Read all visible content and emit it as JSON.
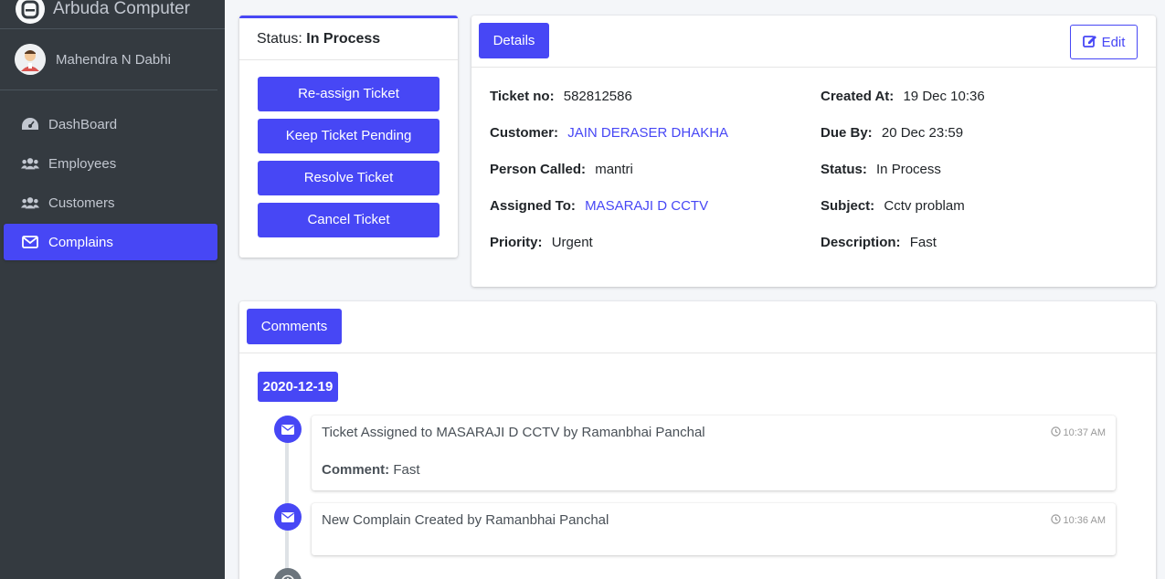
{
  "sidebar": {
    "brand": "Arbuda Computer",
    "user": "Mahendra N Dabhi",
    "items": [
      {
        "label": "DashBoard",
        "icon": "dashboard-icon"
      },
      {
        "label": "Employees",
        "icon": "users-icon"
      },
      {
        "label": "Customers",
        "icon": "users-icon"
      },
      {
        "label": "Complains",
        "icon": "envelope-icon",
        "active": true
      }
    ]
  },
  "status": {
    "label": "Status:",
    "value": "In Process",
    "buttons": [
      "Re-assign Ticket",
      "Keep Ticket Pending",
      "Resolve Ticket",
      "Cancel Ticket"
    ]
  },
  "details": {
    "tab": "Details",
    "edit": "Edit",
    "left": [
      {
        "key": "Ticket no:",
        "value": "582812586"
      },
      {
        "key": "Customer:",
        "value": "JAIN DERASER DHAKHA",
        "link": true
      },
      {
        "key": "Person Called:",
        "value": "mantri"
      },
      {
        "key": "Assigned To:",
        "value": "MASARAJI D CCTV",
        "link": true
      },
      {
        "key": "Priority:",
        "value": "Urgent"
      }
    ],
    "right": [
      {
        "key": "Created At:",
        "value": "19 Dec 10:36"
      },
      {
        "key": "Due By:",
        "value": "20 Dec 23:59"
      },
      {
        "key": "Status:",
        "value": "In Process"
      },
      {
        "key": "Subject:",
        "value": "Cctv problam"
      },
      {
        "key": "Description:",
        "value": "Fast"
      }
    ]
  },
  "comments": {
    "tab": "Comments",
    "date": "2020-12-19",
    "items": [
      {
        "title": "Ticket Assigned to MASARAJI D CCTV by Ramanbhai Panchal",
        "time": "10:37 AM",
        "comment_label": "Comment:",
        "comment": "Fast"
      },
      {
        "title": "New Complain Created by Ramanbhai Panchal",
        "time": "10:36 AM"
      }
    ]
  },
  "colors": {
    "accent": "#4747f5",
    "sidebar": "#343a40"
  }
}
